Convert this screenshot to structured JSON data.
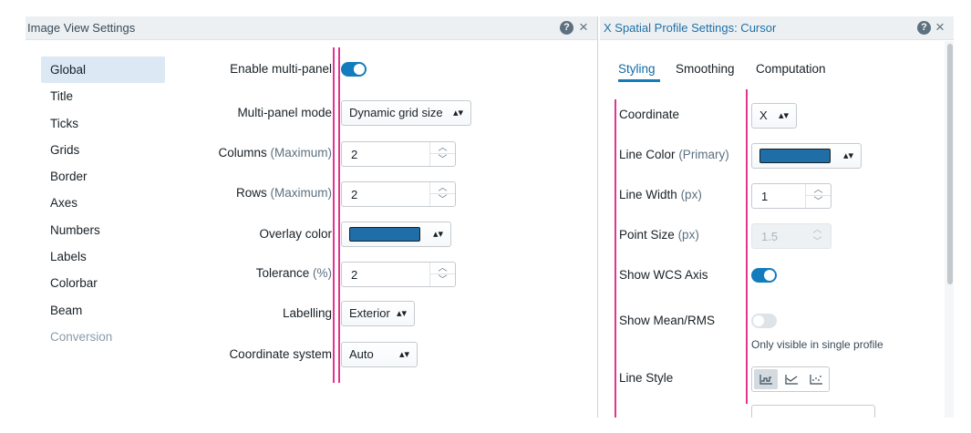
{
  "image_view": {
    "title": "Image View Settings",
    "help": "?",
    "close": "×",
    "nav": [
      {
        "label": "Global",
        "state": "active"
      },
      {
        "label": "Title",
        "state": "normal"
      },
      {
        "label": "Ticks",
        "state": "normal"
      },
      {
        "label": "Grids",
        "state": "normal"
      },
      {
        "label": "Border",
        "state": "normal"
      },
      {
        "label": "Axes",
        "state": "normal"
      },
      {
        "label": "Numbers",
        "state": "normal"
      },
      {
        "label": "Labels",
        "state": "normal"
      },
      {
        "label": "Colorbar",
        "state": "normal"
      },
      {
        "label": "Beam",
        "state": "normal"
      },
      {
        "label": "Conversion",
        "state": "disabled"
      }
    ],
    "fields": {
      "enable_multipanel": {
        "label": "Enable multi-panel",
        "on": true
      },
      "multipanel_mode": {
        "label": "Multi-panel mode",
        "value": "Dynamic grid size"
      },
      "columns": {
        "label": "Columns",
        "hint": "(Maximum)",
        "value": "2"
      },
      "rows": {
        "label": "Rows",
        "hint": "(Maximum)",
        "value": "2"
      },
      "overlay_color": {
        "label": "Overlay color",
        "color": "#1f6ea8"
      },
      "tolerance": {
        "label": "Tolerance",
        "hint": "(%)",
        "value": "2"
      },
      "labelling": {
        "label": "Labelling",
        "value": "Exterior"
      },
      "coordinate_system": {
        "label": "Coordinate system",
        "value": "Auto"
      }
    }
  },
  "profile": {
    "title": "X Spatial Profile Settings: Cursor",
    "help": "?",
    "close": "×",
    "tabs": [
      {
        "label": "Styling",
        "active": true
      },
      {
        "label": "Smoothing",
        "active": false
      },
      {
        "label": "Computation",
        "active": false
      }
    ],
    "fields": {
      "coordinate": {
        "label": "Coordinate",
        "value": "X"
      },
      "line_color": {
        "label": "Line Color",
        "hint": "(Primary)",
        "color": "#1f6ea8"
      },
      "line_width": {
        "label": "Line Width",
        "hint": "(px)",
        "value": "1"
      },
      "point_size": {
        "label": "Point Size",
        "hint": "(px)",
        "value": "1.5",
        "disabled": true
      },
      "show_wcs_axis": {
        "label": "Show WCS Axis",
        "on": true
      },
      "show_mean_rms": {
        "label": "Show Mean/RMS",
        "on": false,
        "helper": "Only visible in single profile"
      },
      "line_style": {
        "label": "Line Style",
        "options": [
          "steps-icon",
          "line-icon",
          "points-icon"
        ],
        "selected": 0
      }
    }
  },
  "colors": {
    "accent": "#137cbd",
    "highlight_line": "#e0358f"
  }
}
